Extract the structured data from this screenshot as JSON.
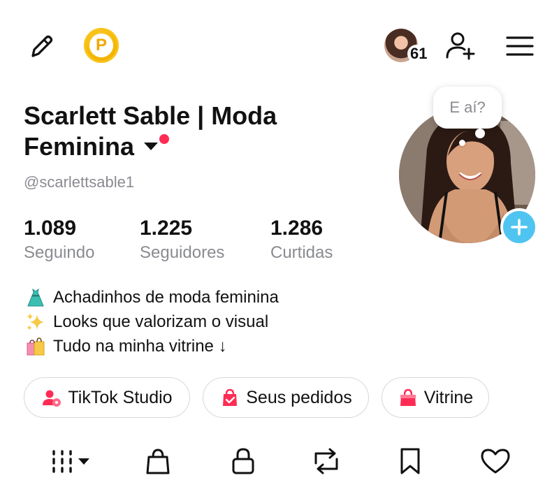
{
  "top_bar": {
    "notification_count": "61",
    "coin_letter": "P"
  },
  "profile": {
    "name_line1": "Scarlett Sable | Moda",
    "name_line2": "Feminina",
    "username": "@scarlettsable1",
    "bubble_text": "E aí?"
  },
  "stats": [
    {
      "value": "1.089",
      "label": "Seguindo"
    },
    {
      "value": "1.225",
      "label": "Seguidores"
    },
    {
      "value": "1.286",
      "label": "Curtidas"
    }
  ],
  "bio": [
    {
      "emoji": "dress",
      "text": "Achadinhos de moda feminina"
    },
    {
      "emoji": "sparkles",
      "text": "Looks que valorizam o visual"
    },
    {
      "emoji": "shopping-bags",
      "text": "Tudo na minha vitrine ↓"
    }
  ],
  "buttons": {
    "studio": "TikTok Studio",
    "orders": "Seus pedidos",
    "showcase": "Vitrine"
  },
  "colors": {
    "accent_red": "#fe2c55",
    "plus_blue": "#4fc4f0",
    "muted_text": "#8a8b91",
    "coin_gold": "#f4b400"
  },
  "tabs": [
    "videos-grid",
    "shop-bag",
    "private-lock",
    "reposts",
    "favorites",
    "liked"
  ]
}
